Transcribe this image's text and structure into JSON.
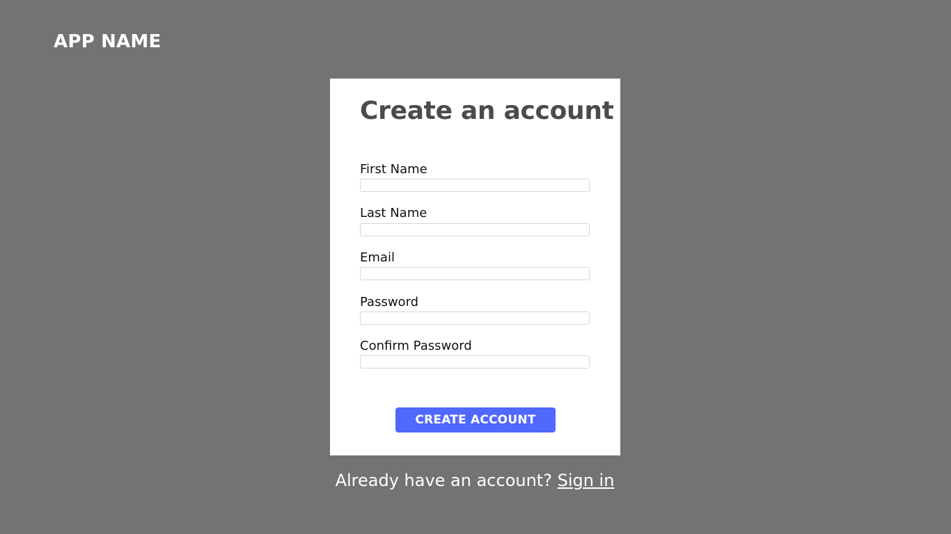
{
  "app": {
    "name": "APP NAME"
  },
  "form": {
    "title": "Create an account",
    "fields": [
      {
        "label": "First Name",
        "value": "",
        "placeholder": ""
      },
      {
        "label": "Last Name",
        "value": "",
        "placeholder": ""
      },
      {
        "label": "Email",
        "value": "",
        "placeholder": ""
      },
      {
        "label": "Password",
        "value": "",
        "placeholder": ""
      },
      {
        "label": "Confirm Password",
        "value": "",
        "placeholder": ""
      }
    ],
    "submit_label": "CREATE ACCOUNT"
  },
  "footer": {
    "prompt_text": "Already have an account? ",
    "link_text": "Sign in"
  },
  "colors": {
    "background": "#737373",
    "card": "#ffffff",
    "title_text": "#4b4b4b",
    "accent": "#5068fb",
    "input_border": "#d6d6d6"
  }
}
